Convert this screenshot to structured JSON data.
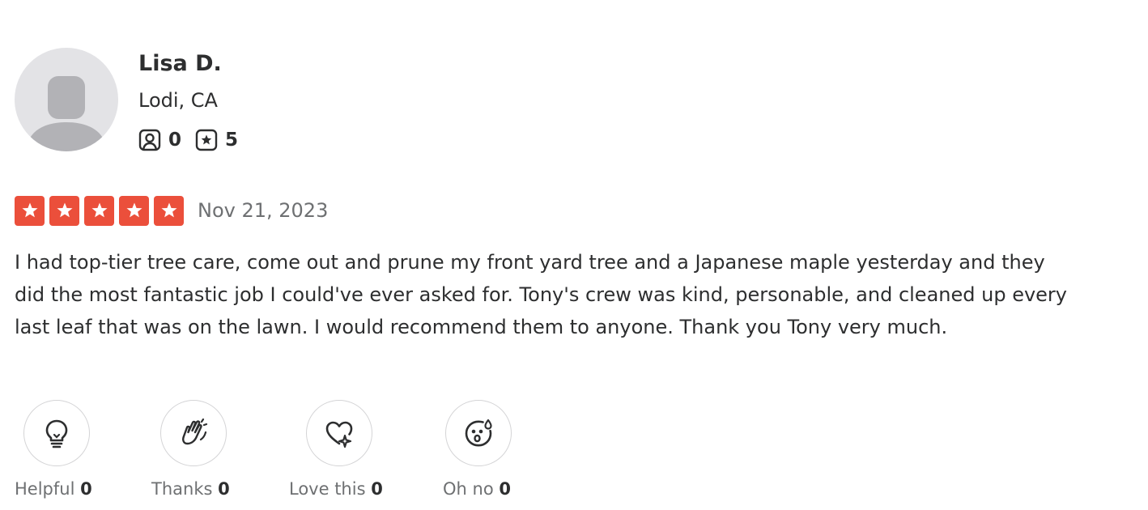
{
  "reviewer": {
    "name": "Lisa D.",
    "location": "Lodi, CA",
    "friends_count": "0",
    "reviews_count": "5"
  },
  "review": {
    "rating": 5,
    "date": "Nov 21, 2023",
    "text": "I had top-tier tree care, come out and prune my front yard tree and a Japanese maple yesterday and they did the most fantastic job I could've ever asked for. Tony's crew was kind, personable, and cleaned up every last leaf that was on the lawn. I would recommend them to anyone. Thank you Tony very much."
  },
  "reactions": [
    {
      "label": "Helpful",
      "count": "0",
      "icon": "lightbulb-icon"
    },
    {
      "label": "Thanks",
      "count": "0",
      "icon": "clapping-hands-icon"
    },
    {
      "label": "Love this",
      "count": "0",
      "icon": "heart-sparkle-icon"
    },
    {
      "label": "Oh no",
      "count": "0",
      "icon": "surprised-face-icon"
    }
  ],
  "colors": {
    "star_red": "#eb4f3b",
    "text_dark": "#2d2e2f",
    "text_gray": "#6e7072",
    "avatar_bg": "#e3e3e6"
  }
}
